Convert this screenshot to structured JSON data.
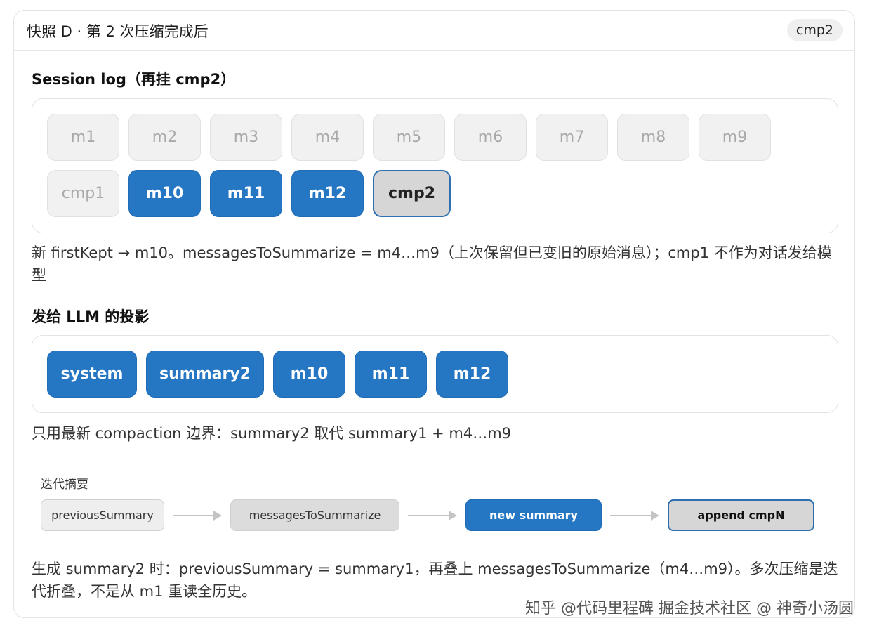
{
  "header": {
    "title": "快照 D · 第 2 次压缩完成后",
    "tag": "cmp2"
  },
  "session_log": {
    "title": "Session log（再挂 cmp2）",
    "rows": [
      [
        {
          "label": "m1",
          "state": "old"
        },
        {
          "label": "m2",
          "state": "old"
        },
        {
          "label": "m3",
          "state": "old"
        },
        {
          "label": "m4",
          "state": "old"
        },
        {
          "label": "m5",
          "state": "old"
        },
        {
          "label": "m6",
          "state": "old"
        },
        {
          "label": "m7",
          "state": "old"
        },
        {
          "label": "m8",
          "state": "old"
        },
        {
          "label": "m9",
          "state": "old"
        }
      ],
      [
        {
          "label": "cmp1",
          "state": "old"
        },
        {
          "label": "m10",
          "state": "kept"
        },
        {
          "label": "m11",
          "state": "kept"
        },
        {
          "label": "m12",
          "state": "kept"
        },
        {
          "label": "cmp2",
          "state": "current"
        }
      ]
    ],
    "note": "新 firstKept → m10。messagesToSummarize = m4…m9（上次保留但已变旧的原始消息）；cmp1 不作为对话发给模型"
  },
  "projection": {
    "title": "发给 LLM 的投影",
    "items": [
      "system",
      "summary2",
      "m10",
      "m11",
      "m12"
    ],
    "note": "只用最新 compaction 边界：summary2 取代 summary1 + m4…m9"
  },
  "flow": {
    "label": "迭代摘要",
    "nodes": [
      {
        "label": "previousSummary",
        "style": "grey"
      },
      {
        "label": "messagesToSummarize",
        "style": "darkgrey"
      },
      {
        "label": "new summary",
        "style": "blue"
      },
      {
        "label": "append cmpN",
        "style": "outlined"
      }
    ]
  },
  "footer_note": "生成 summary2 时：previousSummary = summary1，再叠上 messagesToSummarize（m4…m9）。多次压缩是迭代折叠，不是从 m1 重读全历史。",
  "watermark": "知乎 @代码里程碑 掘金技术社区 @ 神奇小汤圆",
  "colors": {
    "accent_blue": "#2577c4",
    "old_grey": "#f1f1f1",
    "current_border": "#2e6fb0"
  }
}
